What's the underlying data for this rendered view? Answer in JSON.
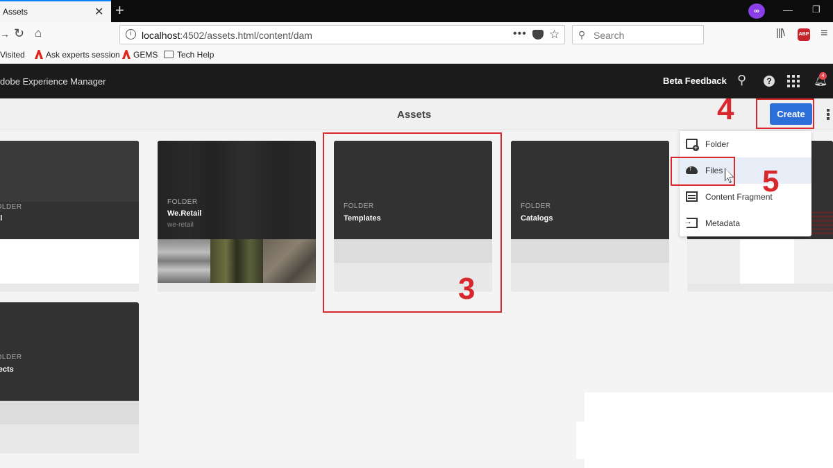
{
  "browser": {
    "tab_title": "Assets",
    "tab_close": "✕",
    "new_tab": "+",
    "url_host": "localhost",
    "url_path": ":4502/assets.html/content/dam",
    "search_placeholder": "Search",
    "bookmarks": [
      {
        "label": "Visited"
      },
      {
        "label": "Ask experts session"
      },
      {
        "label": "GEMS"
      },
      {
        "label": "Tech Help"
      }
    ]
  },
  "aem": {
    "app_title": "dobe Experience Manager",
    "beta_feedback": "Beta Feedback",
    "notification_count": "4",
    "page_title": "Assets",
    "create_label": "Create"
  },
  "cards": [
    {
      "type_label": "FOLDER",
      "name": "vel",
      "sub": ""
    },
    {
      "type_label": "FOLDER",
      "name": "We.Retail",
      "sub": "we-retail"
    },
    {
      "type_label": "FOLDER",
      "name": "Templates",
      "sub": ""
    },
    {
      "type_label": "FOLDER",
      "name": "Catalogs",
      "sub": ""
    },
    {
      "type_label": "FOLDER",
      "name": "ojects",
      "sub": ""
    }
  ],
  "create_menu": [
    {
      "label": "Folder",
      "icon": "folder-add-icon"
    },
    {
      "label": "Files",
      "icon": "cloud-upload-icon"
    },
    {
      "label": "Content Fragment",
      "icon": "content-fragment-icon"
    },
    {
      "label": "Metadata",
      "icon": "metadata-import-icon"
    }
  ],
  "annotations": {
    "step3": "3",
    "step4": "4",
    "step5": "5",
    "color": "#d9272e"
  },
  "colors": {
    "accent": "#2d6fd9",
    "header_bg": "#1b1b1b",
    "card_bg": "#323232"
  }
}
